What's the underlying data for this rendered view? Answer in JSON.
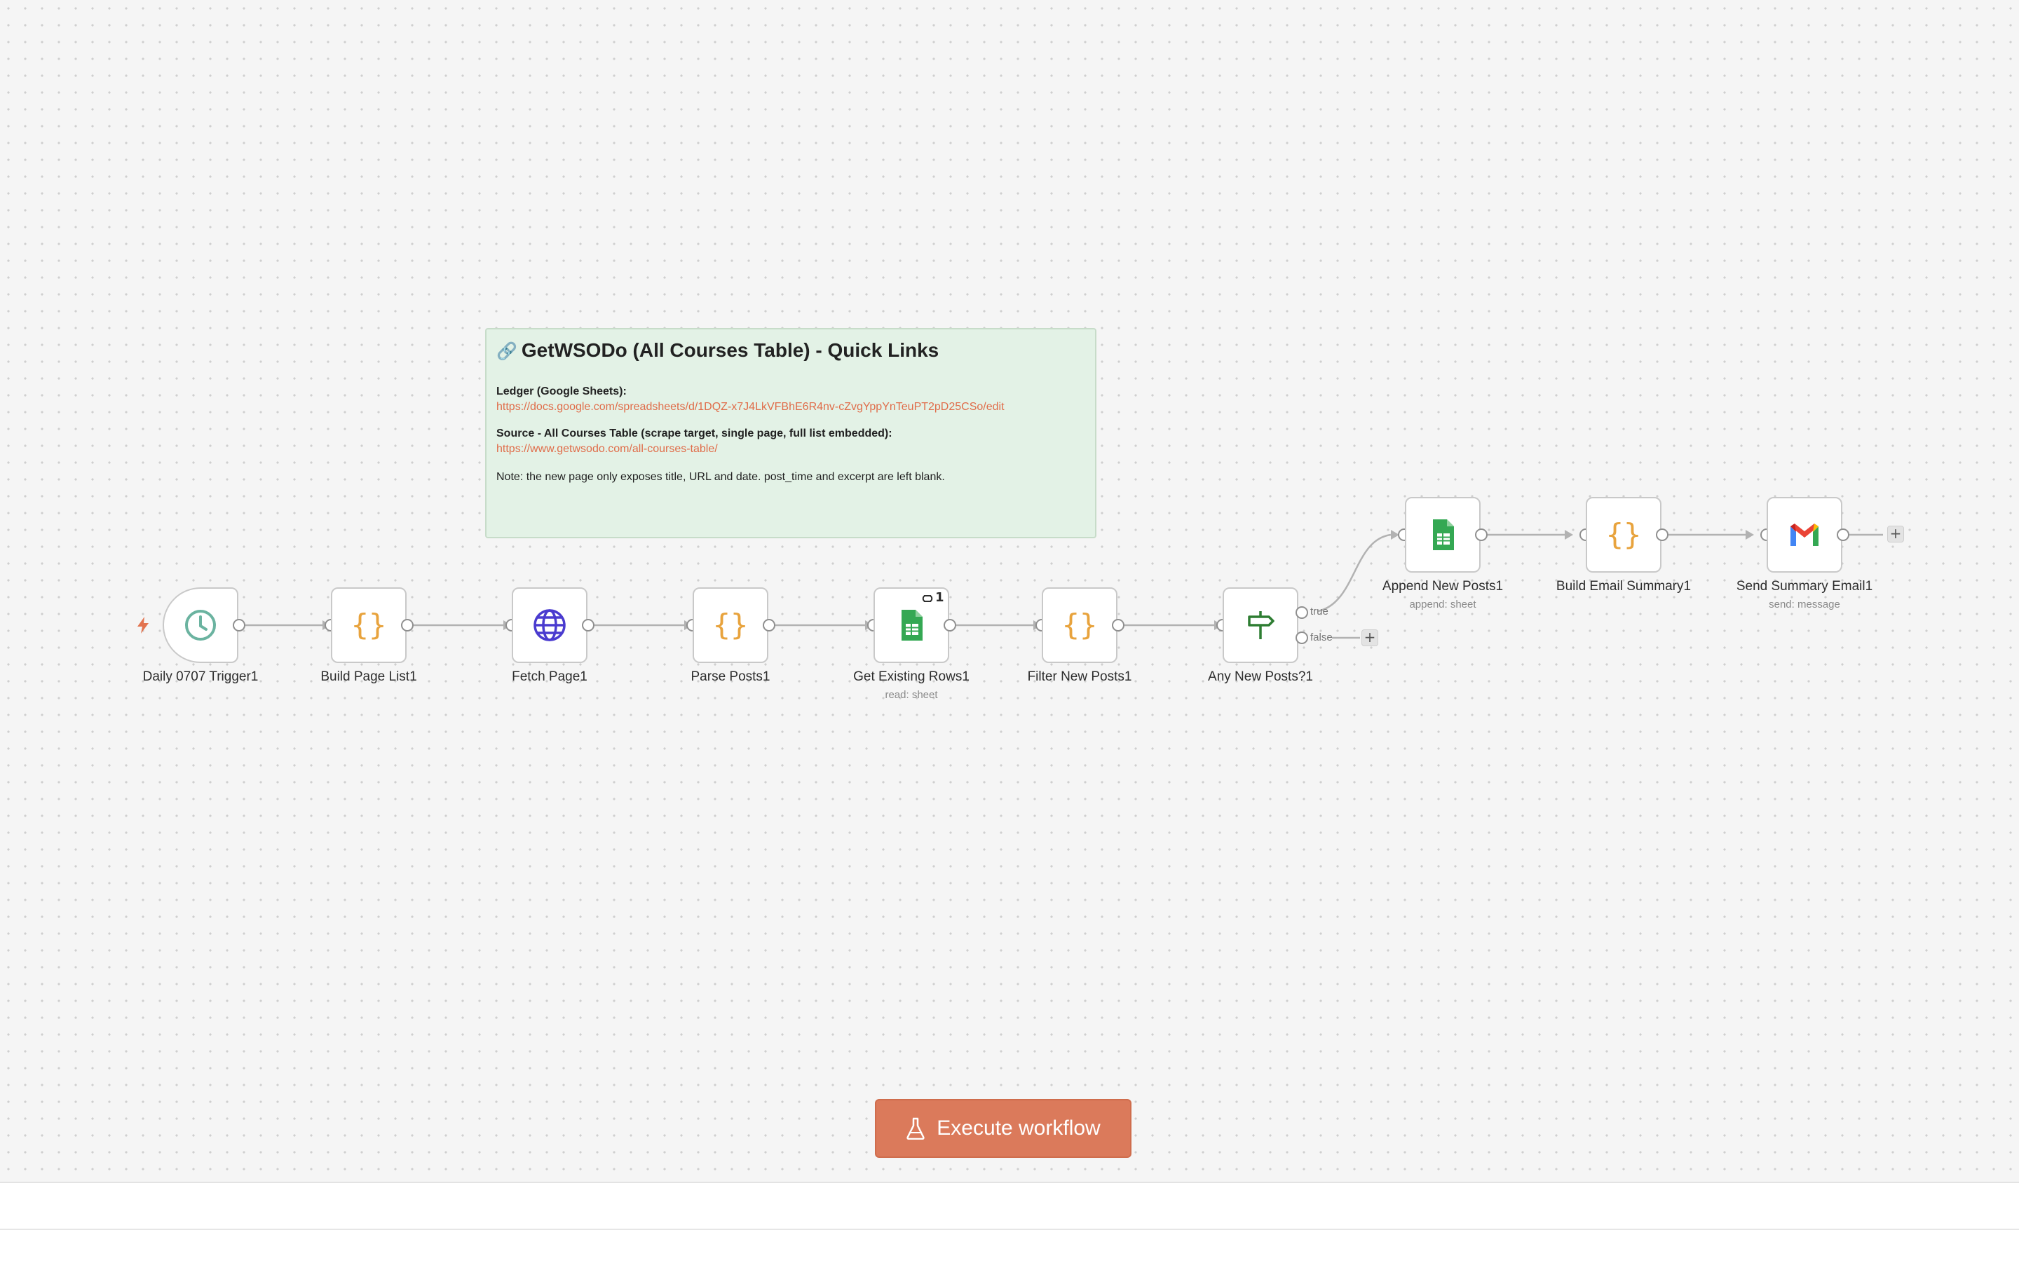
{
  "note": {
    "title": "GetWSODo (All Courses Table) - Quick Links",
    "ledger_heading": "Ledger (Google Sheets):",
    "ledger_url": "https://docs.google.com/spreadsheets/d/1DQZ-x7J4LkVFBhE6R4nv-cZvgYppYnTeuPT2pD25CSo/edit",
    "source_heading": "Source - All Courses Table (scrape target, single page, full list embedded):",
    "source_url": "https://www.getwsodo.com/all-courses-table/",
    "note_text": "Note: the new page only exposes title, URL and date. post_time and excerpt are left blank."
  },
  "nodes": {
    "trigger": {
      "label": "Daily 0707 Trigger1",
      "icon": "clock-icon"
    },
    "build_page_list": {
      "label": "Build Page List1",
      "icon": "code-braces-icon"
    },
    "fetch_page": {
      "label": "Fetch Page1",
      "icon": "globe-icon"
    },
    "parse_posts": {
      "label": "Parse Posts1",
      "icon": "code-braces-icon"
    },
    "get_existing_rows": {
      "label": "Get Existing Rows1",
      "subtitle": "read: sheet",
      "icon": "google-sheets-icon",
      "badge": "1"
    },
    "filter_new_posts": {
      "label": "Filter New Posts1",
      "icon": "code-braces-icon"
    },
    "any_new_posts": {
      "label": "Any New Posts?1",
      "icon": "signpost-icon",
      "true_label": "true",
      "false_label": "false"
    },
    "append_new_posts": {
      "label": "Append New Posts1",
      "subtitle": "append: sheet",
      "icon": "google-sheets-icon"
    },
    "build_email_summary": {
      "label": "Build Email Summary1",
      "icon": "code-braces-icon"
    },
    "send_summary_email": {
      "label": "Send Summary Email1",
      "subtitle": "send: message",
      "icon": "gmail-icon"
    }
  },
  "execute_button": {
    "label": "Execute workflow"
  },
  "colors": {
    "accent": "#db7a5b",
    "code_orange": "#e8a33d",
    "sheets_green": "#34a853",
    "globe_purple": "#4a3bcf",
    "clock_teal": "#6bb3a0",
    "note_bg": "#e3f2e6"
  }
}
